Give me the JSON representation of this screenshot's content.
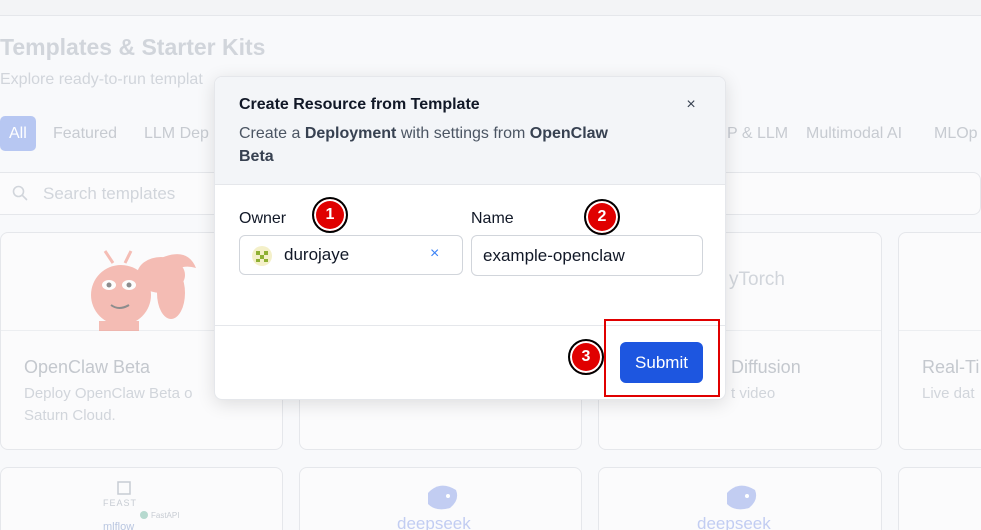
{
  "background": {
    "title": "Templates & Starter Kits",
    "subtitle": "Explore ready-to-run templat",
    "tabs": [
      "All",
      "Featured",
      "LLM Dep",
      "P & LLM",
      "Multimodal AI",
      "MLOp"
    ],
    "search_placeholder": "Search templates",
    "cards": [
      {
        "title": "OpenClaw Beta",
        "desc_line1": "Deploy OpenClaw Beta o",
        "desc_line2": "Saturn Cloud."
      },
      {
        "title": "Diffusion",
        "desc_line1": "t video"
      },
      {
        "title": "Real-Ti",
        "desc_line1": "Live dat"
      }
    ],
    "pytorch_label": "yTorch",
    "logo_texts": [
      "FEAST",
      "FastAPI",
      "mlflow",
      "deepseek",
      "deepseek"
    ]
  },
  "modal": {
    "title": "Create Resource from Template",
    "desc_prefix": "Create a ",
    "desc_resource": "Deployment",
    "desc_middle": " with settings from ",
    "desc_template": "OpenClaw Beta",
    "close_icon": "×",
    "owner_label": "Owner",
    "owner_value": "durojaye",
    "owner_clear_icon": "×",
    "name_label": "Name",
    "name_value": "example-openclaw",
    "submit_label": "Submit"
  },
  "annotations": {
    "badge_1": "1",
    "badge_2": "2",
    "badge_3": "3",
    "color": "#e00000"
  }
}
